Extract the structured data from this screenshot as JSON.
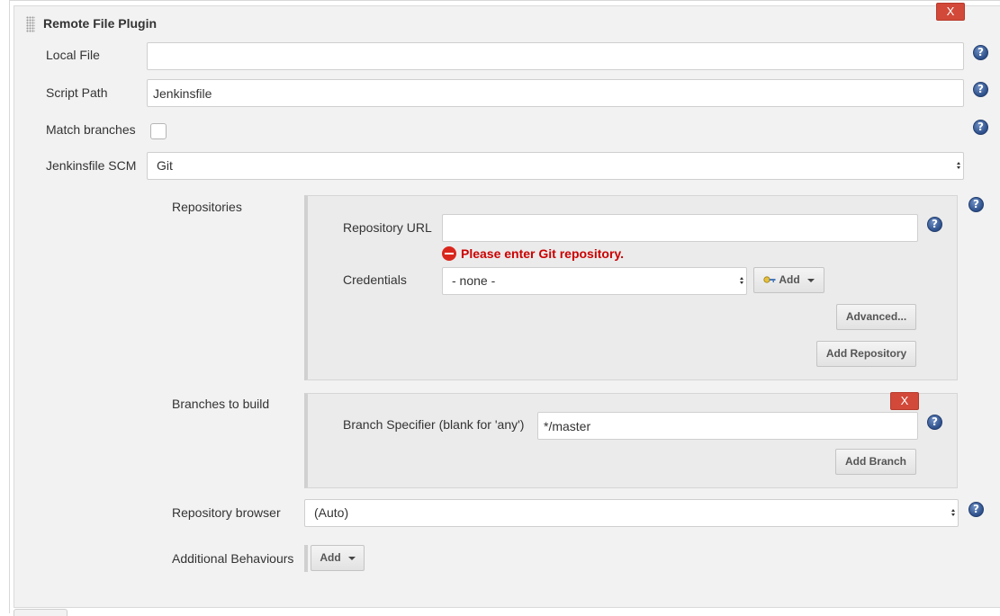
{
  "plugin": {
    "title": "Remote File Plugin",
    "delete_label": "X"
  },
  "fields": {
    "local_file": {
      "label": "Local File",
      "value": ""
    },
    "script_path": {
      "label": "Script Path",
      "value": "Jenkinsfile"
    },
    "match_branches": {
      "label": "Match branches",
      "checked": false
    },
    "jenkinsfile_scm": {
      "label": "Jenkinsfile SCM",
      "selected": "Git"
    }
  },
  "help_label": "?",
  "repositories": {
    "label": "Repositories",
    "repository_url": {
      "label": "Repository URL",
      "value": ""
    },
    "error": "Please enter Git repository.",
    "credentials": {
      "label": "Credentials",
      "selected": "- none -"
    },
    "add_label": "Add",
    "advanced_label": "Advanced...",
    "add_repository_label": "Add Repository"
  },
  "branches": {
    "label": "Branches to build",
    "delete_label": "X",
    "branch_specifier": {
      "label": "Branch Specifier (blank for 'any')",
      "value": "*/master"
    },
    "add_branch_label": "Add Branch"
  },
  "repository_browser": {
    "label": "Repository browser",
    "selected": "(Auto)"
  },
  "additional_behaviours": {
    "label": "Additional Behaviours",
    "add_label": "Add"
  },
  "colors": {
    "delete_button": "#d24939",
    "error_text": "#cc0000",
    "help_icon": "#2d4f8a",
    "panel_bg": "#f2f2f2"
  }
}
